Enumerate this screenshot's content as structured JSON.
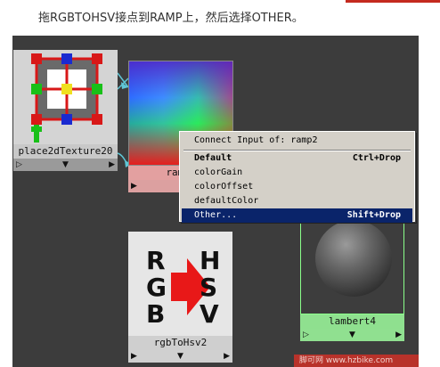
{
  "instruction": "拖RGBTOHSV接点到RAMP上，然后选择OTHER。",
  "nodes": {
    "place2d": {
      "label": "place2dTexture20"
    },
    "ramp": {
      "label": "ramp2"
    },
    "rgbToHsv": {
      "label": "rgbToHsv2",
      "letters_left": [
        "R",
        "G",
        "B"
      ],
      "letters_right": [
        "H",
        "S",
        "V"
      ]
    },
    "lambert": {
      "label": "lambert4"
    }
  },
  "arrows": {
    "left": "▷",
    "mid": "▼",
    "right": "▶"
  },
  "context_menu": {
    "title": "Connect Input of: ramp2",
    "items": [
      {
        "label": "Default",
        "shortcut": "Ctrl+Drop",
        "bold": true
      },
      {
        "label": "colorGain",
        "shortcut": ""
      },
      {
        "label": "colorOffset",
        "shortcut": ""
      },
      {
        "label": "defaultColor",
        "shortcut": ""
      },
      {
        "label": "Other...",
        "shortcut": "Shift+Drop",
        "selected": true
      }
    ]
  },
  "watermark": "脚可网 www.hzbike.com",
  "colors": {
    "accent_red": "#c42a1f",
    "menu_highlight": "#0a246a",
    "graph_bg": "#3c3c3c"
  },
  "icons": [
    "place2d-texture-icon",
    "rgb-to-hsv-icon",
    "lambert-sphere-icon"
  ]
}
